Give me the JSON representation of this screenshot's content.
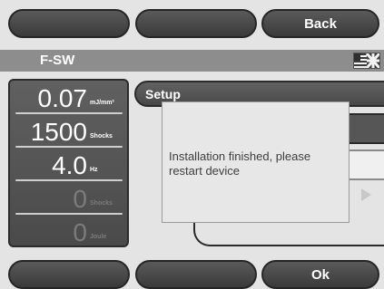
{
  "top_buttons": {
    "left": "",
    "middle": "",
    "back": "Back"
  },
  "header": {
    "title": "F-SW",
    "flag_icon": "language-flag-icon"
  },
  "readouts": [
    {
      "value": "0.07",
      "unit": "mJ/mm²"
    },
    {
      "value": "1500",
      "unit": "Shocks"
    },
    {
      "value": "4.0",
      "unit": "Hz"
    },
    {
      "value": "0",
      "unit": "Shocks"
    },
    {
      "value": "0",
      "unit": "Joule"
    }
  ],
  "menu": {
    "setup_label": "Setup"
  },
  "dialog": {
    "message": "Installation finished, please restart device"
  },
  "bottom_buttons": {
    "left": "",
    "middle": "",
    "ok": "Ok"
  }
}
